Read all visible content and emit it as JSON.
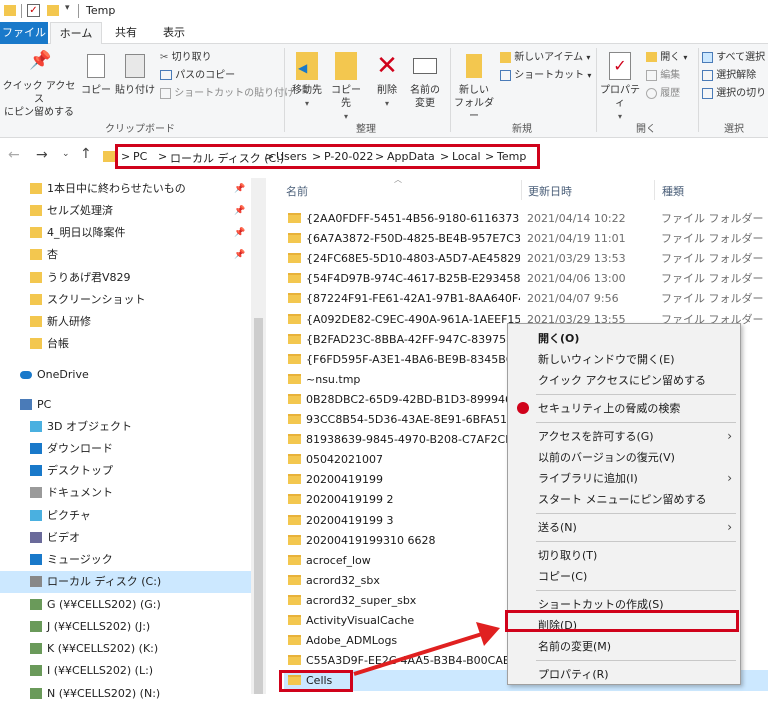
{
  "titlebar": {
    "title": "Temp",
    "qa_icons": [
      "folder-icon",
      "checkbox-icon",
      "folder-icon",
      "dropdown-icon"
    ]
  },
  "tabs": [
    {
      "label": "ファイル"
    },
    {
      "label": "ホーム"
    },
    {
      "label": "共有"
    },
    {
      "label": "表示"
    }
  ],
  "ribbon": {
    "clipboard": {
      "pin_label": "クイック アクセス\nにピン留めする",
      "copy_label": "コピー",
      "paste_label": "貼り付け",
      "cut_label": "切り取り",
      "copy_path_label": "パスのコピー",
      "paste_shortcut_label": "ショートカットの貼り付け",
      "group_label": "クリップボード"
    },
    "organize": {
      "move_label": "移動先",
      "copy_to_label": "コピー先",
      "delete_label": "削除",
      "rename_label": "名前の\n変更",
      "group_label": "整理"
    },
    "new": {
      "new_folder_label": "新しい\nフォルダー",
      "new_item_label": "新しいアイテム",
      "shortcut_label": "ショートカット",
      "group_label": "新規"
    },
    "open": {
      "properties_label": "プロパティ",
      "open_label": "開く",
      "edit_label": "編集",
      "history_label": "履歴",
      "group_label": "開く"
    },
    "select": {
      "select_all_label": "すべて選択",
      "select_none_label": "選択解除",
      "invert_label": "選択の切り",
      "group_label": "選択"
    }
  },
  "address": {
    "crumbs": [
      "PC",
      "ローカル ディスク (C:)",
      "Users",
      "P-20-022",
      "AppData",
      "Local",
      "Temp"
    ],
    "separator": ">"
  },
  "nav": {
    "items": [
      {
        "label": "1本日中に終わらせたいもの",
        "icon": "folder-icon",
        "pinned": true
      },
      {
        "label": "セルズ処理済",
        "icon": "folder-icon",
        "pinned": true
      },
      {
        "label": "4_明日以降案件",
        "icon": "folder-icon",
        "pinned": true
      },
      {
        "label": "杏",
        "icon": "folder-icon",
        "pinned": true
      },
      {
        "label": "うりあげ君V829",
        "icon": "folder-icon",
        "pinned": false
      },
      {
        "label": "スクリーンショット",
        "icon": "folder-icon",
        "pinned": false
      },
      {
        "label": "新人研修",
        "icon": "folder-icon",
        "pinned": false
      },
      {
        "label": "台帳",
        "icon": "folder-icon",
        "pinned": false
      },
      {
        "label": "OneDrive",
        "icon": "cloud-icon",
        "pinned": false
      },
      {
        "label": "PC",
        "icon": "pc-icon",
        "pinned": false
      },
      {
        "label": "3D オブジェクト",
        "icon": "cube-icon",
        "pinned": false
      },
      {
        "label": "ダウンロード",
        "icon": "download-icon",
        "pinned": false
      },
      {
        "label": "デスクトップ",
        "icon": "desktop-icon",
        "pinned": false
      },
      {
        "label": "ドキュメント",
        "icon": "document-icon",
        "pinned": false
      },
      {
        "label": "ピクチャ",
        "icon": "picture-icon",
        "pinned": false
      },
      {
        "label": "ビデオ",
        "icon": "video-icon",
        "pinned": false
      },
      {
        "label": "ミュージック",
        "icon": "music-icon",
        "pinned": false
      },
      {
        "label": "ローカル ディスク (C:)",
        "icon": "disk-icon",
        "pinned": false,
        "selected": true
      },
      {
        "label": "G (¥¥CELLS202) (G:)",
        "icon": "network-drive-icon",
        "pinned": false
      },
      {
        "label": "J (¥¥CELLS202) (J:)",
        "icon": "network-drive-icon",
        "pinned": false
      },
      {
        "label": "K (¥¥CELLS202) (K:)",
        "icon": "network-drive-icon",
        "pinned": false
      },
      {
        "label": "I (¥¥CELLS202) (L:)",
        "icon": "network-drive-icon",
        "pinned": false
      },
      {
        "label": "N (¥¥CELLS202) (N:)",
        "icon": "network-drive-icon",
        "pinned": false
      }
    ],
    "pin_glyph": "📌"
  },
  "columns": {
    "name": "名前",
    "date": "更新日時",
    "type": "種類"
  },
  "files": [
    {
      "name": "{2AA0FDFF-5451-4B56-9180-6116373548...",
      "date": "2021/04/14 10:22",
      "type": "ファイル フォルダー"
    },
    {
      "name": "{6A7A3872-F50D-4825-BE4B-957E7C3C0...",
      "date": "2021/04/19 11:01",
      "type": "ファイル フォルダー"
    },
    {
      "name": "{24FC68E5-5D10-4803-A5D7-AE45829F3...",
      "date": "2021/03/29 13:53",
      "type": "ファイル フォルダー"
    },
    {
      "name": "{54F4D97B-974C-4617-B25B-E29345832...",
      "date": "2021/04/06 13:00",
      "type": "ファイル フォルダー"
    },
    {
      "name": "{87224F91-FE61-42A1-97B1-8AA640F4B...",
      "date": "2021/04/07 9:56",
      "type": "ファイル フォルダー"
    },
    {
      "name": "{A092DE82-C9EC-490A-961A-1AEEF1576...",
      "date": "2021/03/29 13:55",
      "type": "ファイル フォルダー"
    },
    {
      "name": "{B2FAD23C-8BBA-42FF-947C-839758C07",
      "date": "",
      "type": ""
    },
    {
      "name": "{F6FD595F-A3E1-4BA6-BE9B-8345B6C99",
      "date": "",
      "type": ""
    },
    {
      "name": "~nsu.tmp",
      "date": "",
      "type": ""
    },
    {
      "name": "0B28DBC2-65D9-42BD-B1D3-8999462D",
      "date": "",
      "type": ""
    },
    {
      "name": "93CC8B54-5D36-43AE-8E91-6BFA51B71",
      "date": "",
      "type": ""
    },
    {
      "name": "81938639-9845-4970-B208-C7AF2CEE76",
      "date": "",
      "type": ""
    },
    {
      "name": "05042021007",
      "date": "",
      "type": ""
    },
    {
      "name": "20200419199",
      "date": "",
      "type": ""
    },
    {
      "name": "20200419199 2",
      "date": "",
      "type": ""
    },
    {
      "name": "20200419199 3",
      "date": "",
      "type": ""
    },
    {
      "name": "20200419199310 6628",
      "date": "",
      "type": ""
    },
    {
      "name": "acrocef_low",
      "date": "",
      "type": ""
    },
    {
      "name": "acrord32_sbx",
      "date": "",
      "type": ""
    },
    {
      "name": "acrord32_super_sbx",
      "date": "",
      "type": ""
    },
    {
      "name": "ActivityVisualCache",
      "date": "",
      "type": ""
    },
    {
      "name": "Adobe_ADMLogs",
      "date": "",
      "type": ""
    },
    {
      "name": "C55A3D9F-EE2C-4AA5-B3B4-B00CAB851",
      "date": "",
      "type": ""
    },
    {
      "name": "Cells",
      "date": "",
      "type": ""
    }
  ],
  "context_menu": [
    {
      "label": "開く(O)",
      "bold": true
    },
    {
      "label": "新しいウィンドウで開く(E)"
    },
    {
      "label": "クイック アクセスにピン留めする"
    },
    {
      "sep": true
    },
    {
      "label": "セキュリティ上の脅威の検索",
      "icon": "security-icon"
    },
    {
      "sep": true
    },
    {
      "label": "アクセスを許可する(G)",
      "arrow": true
    },
    {
      "label": "以前のバージョンの復元(V)"
    },
    {
      "label": "ライブラリに追加(I)",
      "arrow": true
    },
    {
      "label": "スタート メニューにピン留めする"
    },
    {
      "sep": true
    },
    {
      "label": "送る(N)",
      "arrow": true
    },
    {
      "sep": true
    },
    {
      "label": "切り取り(T)"
    },
    {
      "label": "コピー(C)"
    },
    {
      "sep": true
    },
    {
      "label": "ショートカットの作成(S)"
    },
    {
      "label": "削除(D)",
      "highlight": true
    },
    {
      "label": "名前の変更(M)"
    },
    {
      "sep": true
    },
    {
      "label": "プロパティ(R)"
    }
  ],
  "colors": {
    "accent": "#1979ca",
    "highlight": "#d0021b",
    "selection": "#cce8ff",
    "folder": "#f3c74f"
  }
}
